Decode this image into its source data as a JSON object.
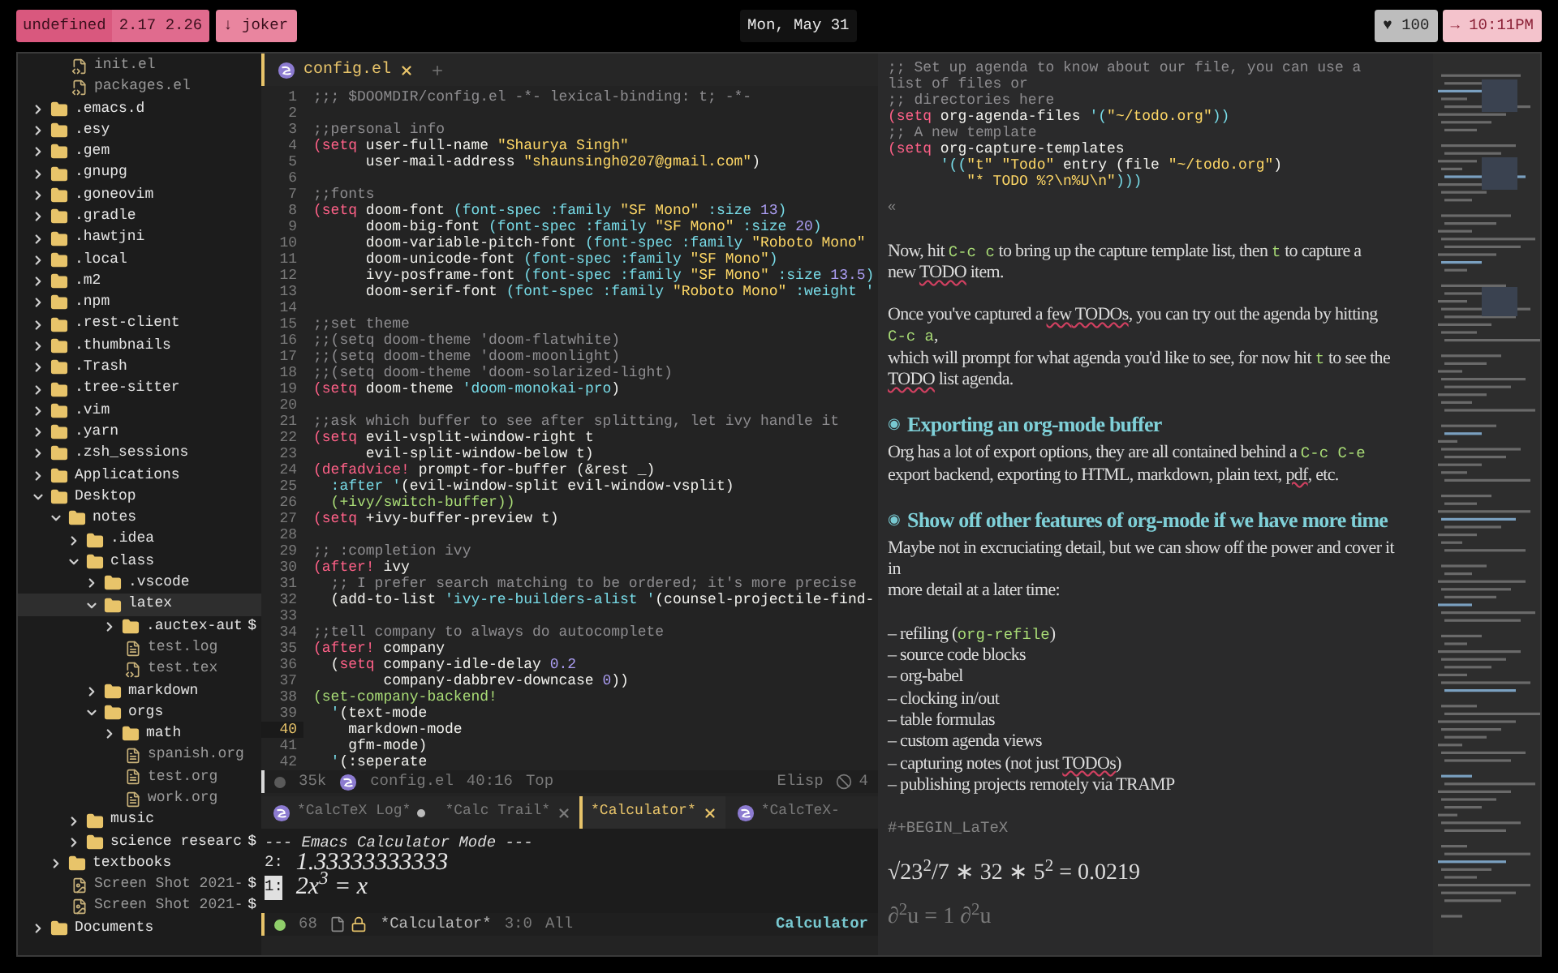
{
  "topbar": {
    "workspace": "undefined",
    "load": "2.17 2.26",
    "branch": "↓ joker",
    "date": "Mon, May 31",
    "battery": "♥ 100",
    "time": "→ 10:11PM"
  },
  "sidebar": {
    "items": [
      {
        "kind": "continuation",
        "children": [
          {
            "name": "init.el",
            "kind": "code",
            "selected": false
          },
          {
            "name": "packages.el",
            "kind": "code",
            "selected": false
          }
        ]
      },
      {
        "name": ".emacs.d",
        "kind": "folder",
        "expanded": false,
        "selected": false
      },
      {
        "name": ".esy",
        "kind": "folder",
        "expanded": false,
        "selected": false
      },
      {
        "name": ".gem",
        "kind": "folder",
        "expanded": false,
        "selected": false
      },
      {
        "name": ".gnupg",
        "kind": "folder",
        "expanded": false,
        "selected": false
      },
      {
        "name": ".goneovim",
        "kind": "folder",
        "expanded": false,
        "selected": false
      },
      {
        "name": ".gradle",
        "kind": "folder",
        "expanded": false,
        "selected": false
      },
      {
        "name": ".hawtjni",
        "kind": "folder",
        "expanded": false,
        "selected": false
      },
      {
        "name": ".local",
        "kind": "folder",
        "expanded": false,
        "selected": false
      },
      {
        "name": ".m2",
        "kind": "folder",
        "expanded": false,
        "selected": false
      },
      {
        "name": ".npm",
        "kind": "folder",
        "expanded": false,
        "selected": false
      },
      {
        "name": ".rest-client",
        "kind": "folder",
        "expanded": false,
        "selected": false
      },
      {
        "name": ".thumbnails",
        "kind": "folder",
        "expanded": false,
        "selected": false
      },
      {
        "name": ".Trash",
        "kind": "folder",
        "expanded": false,
        "selected": false
      },
      {
        "name": ".tree-sitter",
        "kind": "folder",
        "expanded": false,
        "selected": false
      },
      {
        "name": ".vim",
        "kind": "folder",
        "expanded": false,
        "selected": false
      },
      {
        "name": ".yarn",
        "kind": "folder",
        "expanded": false,
        "selected": false
      },
      {
        "name": ".zsh_sessions",
        "kind": "folder",
        "expanded": false,
        "selected": false
      },
      {
        "name": "Applications",
        "kind": "folder",
        "expanded": false,
        "selected": false
      },
      {
        "name": "Desktop",
        "kind": "folder",
        "expanded": true,
        "selected": false,
        "children": [
          {
            "name": "notes",
            "kind": "folder",
            "expanded": true,
            "selected": false,
            "children": [
              {
                "name": ".idea",
                "kind": "folder",
                "expanded": false,
                "selected": false
              },
              {
                "name": "class",
                "kind": "folder",
                "expanded": true,
                "selected": false,
                "children": [
                  {
                    "name": ".vscode",
                    "kind": "folder",
                    "expanded": false,
                    "selected": false
                  },
                  {
                    "name": "latex",
                    "kind": "folder",
                    "expanded": true,
                    "selected": true,
                    "children": [
                      {
                        "name": ".auctex-aut",
                        "kind": "folder",
                        "expanded": false,
                        "selected": false,
                        "marker": "$"
                      },
                      {
                        "name": "test.log",
                        "kind": "text",
                        "selected": false
                      },
                      {
                        "name": "test.tex",
                        "kind": "code",
                        "selected": false
                      }
                    ]
                  },
                  {
                    "name": "markdown",
                    "kind": "folder",
                    "expanded": false,
                    "selected": false
                  },
                  {
                    "name": "orgs",
                    "kind": "folder",
                    "expanded": true,
                    "selected": false,
                    "children": [
                      {
                        "name": "math",
                        "kind": "folder",
                        "expanded": false,
                        "selected": false
                      },
                      {
                        "name": "spanish.org",
                        "kind": "text",
                        "selected": false
                      },
                      {
                        "name": "test.org",
                        "kind": "text",
                        "selected": false
                      },
                      {
                        "name": "work.org",
                        "kind": "text",
                        "selected": false
                      }
                    ]
                  }
                ]
              },
              {
                "name": "music",
                "kind": "folder",
                "expanded": false,
                "selected": false
              },
              {
                "name": "science researc",
                "kind": "folder",
                "expanded": false,
                "selected": false,
                "marker": "$"
              }
            ]
          },
          {
            "name": "textbooks",
            "kind": "folder",
            "expanded": false,
            "selected": false
          },
          {
            "name": "Screen Shot 2021-",
            "kind": "image",
            "selected": false,
            "marker": "$"
          },
          {
            "name": "Screen Shot 2021-",
            "kind": "image",
            "selected": false,
            "marker": "$"
          }
        ]
      },
      {
        "name": "Documents",
        "kind": "folder",
        "expanded": false,
        "selected": false
      }
    ]
  },
  "editor": {
    "tabs": [
      {
        "label": "config.el",
        "selected": true
      }
    ],
    "lines": [
      {
        "number": "1",
        "current": false,
        "parts": [
          {
            "text": ";;; $DOOMDIR/config.el -*- lexical-binding: t; -*-",
            "kind": "c"
          }
        ]
      },
      {
        "number": "2",
        "current": false
      },
      {
        "number": "3",
        "current": false,
        "parts": [
          {
            "text": ";;personal info",
            "kind": "c"
          }
        ]
      },
      {
        "number": "4",
        "current": false,
        "parts": [
          {
            "text": "(setq",
            "kind": "k"
          },
          {
            "text": " user-full-name ",
            "kind": "d"
          },
          {
            "text": "\"Shaurya Singh\"",
            "kind": "s"
          }
        ]
      },
      {
        "number": "5",
        "current": false,
        "parts": [
          {
            "text": "      user-mail-address ",
            "kind": "d"
          },
          {
            "text": "\"shaunsingh0207@gmail.com\"",
            "kind": "s"
          },
          {
            "text": ")",
            "kind": "d"
          }
        ]
      },
      {
        "number": "6",
        "current": false
      },
      {
        "number": "7",
        "current": false,
        "parts": [
          {
            "text": ";;fonts",
            "kind": "c"
          }
        ]
      },
      {
        "number": "8",
        "current": false,
        "parts": [
          {
            "text": "(setq",
            "kind": "k"
          },
          {
            "text": " doom-font ",
            "kind": "d"
          },
          {
            "text": "(font-spec :family ",
            "kind": "f"
          },
          {
            "text": "\"SF Mono\"",
            "kind": "s"
          },
          {
            "text": " :size ",
            "kind": "f"
          },
          {
            "text": "13",
            "kind": "n"
          },
          {
            "text": ")",
            "kind": "f"
          }
        ]
      },
      {
        "number": "9",
        "current": false,
        "parts": [
          {
            "text": "      doom-big-font ",
            "kind": "d"
          },
          {
            "text": "(font-spec :family ",
            "kind": "f"
          },
          {
            "text": "\"SF Mono\"",
            "kind": "s"
          },
          {
            "text": " :size ",
            "kind": "f"
          },
          {
            "text": "20",
            "kind": "n"
          },
          {
            "text": ")",
            "kind": "f"
          }
        ]
      },
      {
        "number": "10",
        "current": false,
        "parts": [
          {
            "text": "      doom-variable-pitch-font ",
            "kind": "d"
          },
          {
            "text": "(font-spec :family ",
            "kind": "f"
          },
          {
            "text": "\"Roboto Mono\"",
            "kind": "s"
          }
        ]
      },
      {
        "number": "11",
        "current": false,
        "parts": [
          {
            "text": "      doom-unicode-font ",
            "kind": "d"
          },
          {
            "text": "(font-spec :family ",
            "kind": "f"
          },
          {
            "text": "\"SF Mono\"",
            "kind": "s"
          },
          {
            "text": ")",
            "kind": "f"
          }
        ]
      },
      {
        "number": "12",
        "current": false,
        "parts": [
          {
            "text": "      ivy-posframe-font ",
            "kind": "d"
          },
          {
            "text": "(font-spec :family ",
            "kind": "f"
          },
          {
            "text": "\"SF Mono\"",
            "kind": "s"
          },
          {
            "text": " :size ",
            "kind": "f"
          },
          {
            "text": "13.5",
            "kind": "n"
          },
          {
            "text": ")",
            "kind": "f"
          }
        ]
      },
      {
        "number": "13",
        "current": false,
        "parts": [
          {
            "text": "      doom-serif-font ",
            "kind": "d"
          },
          {
            "text": "(font-spec :family ",
            "kind": "f"
          },
          {
            "text": "\"Roboto Mono\"",
            "kind": "s"
          },
          {
            "text": " :weight '",
            "kind": "f"
          }
        ]
      },
      {
        "number": "14",
        "current": false
      },
      {
        "number": "15",
        "current": false,
        "parts": [
          {
            "text": ";;set theme",
            "kind": "c"
          }
        ]
      },
      {
        "number": "16",
        "current": false,
        "parts": [
          {
            "text": ";;(setq doom-theme 'doom-flatwhite)",
            "kind": "c"
          }
        ]
      },
      {
        "number": "17",
        "current": false,
        "parts": [
          {
            "text": ";;(setq doom-theme 'doom-moonlight)",
            "kind": "c"
          }
        ]
      },
      {
        "number": "18",
        "current": false,
        "parts": [
          {
            "text": ";;(setq doom-theme 'doom-solarized-light)",
            "kind": "c"
          }
        ]
      },
      {
        "number": "19",
        "current": false,
        "parts": [
          {
            "text": "(setq",
            "kind": "k"
          },
          {
            "text": " doom-theme ",
            "kind": "d"
          },
          {
            "text": "'doom-monokai-pro",
            "kind": "f"
          },
          {
            "text": ")",
            "kind": "d"
          }
        ]
      },
      {
        "number": "20",
        "current": false
      },
      {
        "number": "21",
        "current": false,
        "parts": [
          {
            "text": ";;ask which buffer to see after splitting, let ivy handle it",
            "kind": "c"
          }
        ]
      },
      {
        "number": "22",
        "current": false,
        "parts": [
          {
            "text": "(setq",
            "kind": "k"
          },
          {
            "text": " evil-vsplit-window-right t",
            "kind": "d"
          }
        ]
      },
      {
        "number": "23",
        "current": false,
        "parts": [
          {
            "text": "      evil-split-window-below t)",
            "kind": "d"
          }
        ]
      },
      {
        "number": "24",
        "current": false,
        "parts": [
          {
            "text": "(defadvice!",
            "kind": "k"
          },
          {
            "text": " prompt-for-buffer (&rest _)",
            "kind": "d"
          }
        ]
      },
      {
        "number": "25",
        "current": false,
        "parts": [
          {
            "text": "  :after '",
            "kind": "f"
          },
          {
            "text": "(evil-window-split evil-window-vsplit)",
            "kind": "d"
          }
        ]
      },
      {
        "number": "26",
        "current": false,
        "parts": [
          {
            "text": "  (+ivy/switch-buffer))",
            "kind": "g"
          }
        ]
      },
      {
        "number": "27",
        "current": false,
        "parts": [
          {
            "text": "(setq",
            "kind": "k"
          },
          {
            "text": " +ivy-buffer-preview t)",
            "kind": "d"
          }
        ]
      },
      {
        "number": "28",
        "current": false
      },
      {
        "number": "29",
        "current": false,
        "parts": [
          {
            "text": ";; :completion ivy",
            "kind": "c"
          }
        ]
      },
      {
        "number": "30",
        "current": false,
        "parts": [
          {
            "text": "(after!",
            "kind": "k"
          },
          {
            "text": " ivy",
            "kind": "d"
          }
        ]
      },
      {
        "number": "31",
        "current": false,
        "parts": [
          {
            "text": "  ;; I prefer search matching to be ordered; it's more precise",
            "kind": "c"
          }
        ]
      },
      {
        "number": "32",
        "current": false,
        "parts": [
          {
            "text": "  (add-to-list ",
            "kind": "d"
          },
          {
            "text": "'ivy-re-builders-alist '",
            "kind": "f"
          },
          {
            "text": "(counsel-projectile-find-",
            "kind": "d"
          }
        ]
      },
      {
        "number": "33",
        "current": false
      },
      {
        "number": "34",
        "current": false,
        "parts": [
          {
            "text": ";;tell company to always do autocomplete",
            "kind": "c"
          }
        ]
      },
      {
        "number": "35",
        "current": false,
        "parts": [
          {
            "text": "(after!",
            "kind": "k"
          },
          {
            "text": " company",
            "kind": "d"
          }
        ]
      },
      {
        "number": "36",
        "current": false,
        "parts": [
          {
            "text": "  (",
            "kind": "d"
          },
          {
            "text": "setq",
            "kind": "k"
          },
          {
            "text": " company-idle-delay ",
            "kind": "d"
          },
          {
            "text": "0.2",
            "kind": "n"
          }
        ]
      },
      {
        "number": "37",
        "current": false,
        "parts": [
          {
            "text": "        company-dabbrev-downcase ",
            "kind": "d"
          },
          {
            "text": "0",
            "kind": "n"
          },
          {
            "text": "))",
            "kind": "d"
          }
        ]
      },
      {
        "number": "38",
        "current": false,
        "parts": [
          {
            "text": "(set-company-backend!",
            "kind": "g"
          }
        ]
      },
      {
        "number": "39",
        "current": false,
        "parts": [
          {
            "text": "  '",
            "kind": "f"
          },
          {
            "text": "(text-mode",
            "kind": "d"
          }
        ]
      },
      {
        "number": "40",
        "current": true,
        "parts": [
          {
            "text": "    markdown-mode",
            "kind": "d"
          }
        ]
      },
      {
        "number": "41",
        "current": false,
        "parts": [
          {
            "text": "    gfm-mode)",
            "kind": "d"
          }
        ]
      },
      {
        "number": "42",
        "current": false,
        "parts": [
          {
            "text": "  '",
            "kind": "f"
          },
          {
            "text": "(:seperate",
            "kind": "d"
          }
        ]
      }
    ],
    "modeline": {
      "size": "35k",
      "buffer": "config.el",
      "position": "40:16",
      "scroll": "Top",
      "mode": "Elisp",
      "extra": "4"
    }
  },
  "calc": {
    "tabs": [
      {
        "label": "*CalcTeX Log*",
        "logo": true,
        "modified": true,
        "closable": false,
        "selected": false
      },
      {
        "label": "*Calc Trail*",
        "logo": false,
        "modified": false,
        "closable": true,
        "selected": false
      },
      {
        "label": "*Calculator*",
        "logo": false,
        "modified": false,
        "closable": true,
        "selected": true
      },
      {
        "label": "*CalcTeX-",
        "logo": true,
        "modified": false,
        "closable": false,
        "selected": false
      }
    ],
    "header": "--- Emacs Calculator Mode ---",
    "stack": [
      {
        "index": "2:",
        "value": "1.33333333333",
        "cursor": false
      },
      {
        "index": "1:",
        "value": "2x$^{3}$ = x",
        "cursor": true
      }
    ],
    "modeline": {
      "size": "68",
      "buffer": "*Calculator*",
      "position": "3:0",
      "scroll": "All",
      "mode": "Calculator"
    }
  },
  "org": {
    "blocks": [
      {
        "kind": "code",
        "lines": [
          [
            {
              "text": ";; Set up agenda to know about our file, you can use a",
              "kind": "c"
            }
          ],
          [
            {
              "text": "list of files or",
              "kind": "c"
            }
          ],
          [
            {
              "text": ";; directories here",
              "kind": "c"
            }
          ],
          [
            {
              "text": "(setq",
              "kind": "k"
            },
            {
              "text": " org-agenda-files ",
              "kind": "d"
            },
            {
              "text": "'(",
              "kind": "f"
            },
            {
              "text": "\"~/todo.org\"",
              "kind": "s"
            },
            {
              "text": "))",
              "kind": "f"
            }
          ],
          [
            {
              "text": ";; A new template",
              "kind": "c"
            }
          ],
          [
            {
              "text": "(setq",
              "kind": "k"
            },
            {
              "text": " org-capture-templates",
              "kind": "d"
            }
          ],
          [
            {
              "text": "      '((",
              "kind": "f"
            },
            {
              "text": "\"t\" \"Todo\"",
              "kind": "s"
            },
            {
              "text": " entry (file ",
              "kind": "d"
            },
            {
              "text": "\"~/todo.org\"",
              "kind": "s"
            },
            {
              "text": ")",
              "kind": "d"
            }
          ],
          [
            {
              "text": "         \"* TODO %?\\n%U\\n\"",
              "kind": "s"
            },
            {
              "text": ")))",
              "kind": "f"
            }
          ]
        ]
      },
      {
        "kind": "glyph",
        "text": "«"
      },
      {
        "kind": "paragraph",
        "lines": [
          [
            {
              "text": "Now, hit ",
              "kind": "t"
            },
            {
              "text": "C-c c",
              "kind": "code"
            },
            {
              "text": " to bring up the capture template list, then ",
              "kind": "t"
            },
            {
              "text": "t",
              "kind": "code"
            },
            {
              "text": " to capture a",
              "kind": "t"
            }
          ],
          [
            {
              "text": "new ",
              "kind": "t"
            },
            {
              "text": "TODO",
              "kind": "spell"
            },
            {
              "text": " item.",
              "kind": "t"
            }
          ]
        ]
      },
      {
        "kind": "paragraph",
        "lines": [
          [
            {
              "text": "Once you've captured a ",
              "kind": "t"
            },
            {
              "text": "few",
              "kind": "spell"
            },
            {
              "text": " TODOs",
              "kind": "spell"
            },
            {
              "text": ", you can try out the agenda by hitting",
              "kind": "t"
            }
          ],
          [
            {
              "text": "C-c a",
              "kind": "code"
            },
            {
              "text": ",",
              "kind": "t"
            }
          ],
          [
            {
              "text": "which will prompt for what agenda you'd like to see, for now hit ",
              "kind": "t"
            },
            {
              "text": "t",
              "kind": "code"
            },
            {
              "text": " to see the",
              "kind": "t"
            }
          ],
          [
            {
              "text": "TODO",
              "kind": "spell"
            },
            {
              "text": " list agenda.",
              "kind": "t"
            }
          ]
        ]
      },
      {
        "kind": "heading",
        "marker": "◉",
        "text": "Exporting an org-mode buffer"
      },
      {
        "kind": "paragraph",
        "lines": [
          [
            {
              "text": "Org has a lot of export options, they are all contained behind a ",
              "kind": "t"
            },
            {
              "text": "C-c C-e",
              "kind": "code"
            }
          ],
          [
            {
              "text": "export backend, exporting to HTML, markdown, plain text, ",
              "kind": "t"
            },
            {
              "text": "pdf",
              "kind": "spell"
            },
            {
              "text": ", etc.",
              "kind": "t"
            }
          ]
        ]
      },
      {
        "kind": "heading",
        "marker": "◉",
        "text": "Show off other features of org-mode if we have more time"
      },
      {
        "kind": "paragraph",
        "lines": [
          [
            {
              "text": "Maybe not in excruciating detail, but we can show off the power and cover it",
              "kind": "t"
            }
          ],
          [
            {
              "text": "in",
              "kind": "t"
            }
          ],
          [
            {
              "text": "more detail at a later time:",
              "kind": "t"
            }
          ]
        ]
      },
      {
        "kind": "paragraph",
        "lines": [
          [
            {
              "text": "– refiling (",
              "kind": "t"
            },
            {
              "text": "org-refile",
              "kind": "code"
            },
            {
              "text": ")",
              "kind": "t"
            }
          ],
          [
            {
              "text": "– source code blocks",
              "kind": "t"
            }
          ],
          [
            {
              "text": "– org-babel",
              "kind": "t"
            }
          ],
          [
            {
              "text": "– clocking in/out",
              "kind": "t"
            }
          ],
          [
            {
              "text": "– table formulas",
              "kind": "t"
            }
          ],
          [
            {
              "text": "– custom agenda views",
              "kind": "t"
            }
          ],
          [
            {
              "text": "– capturing notes (not just ",
              "kind": "t"
            },
            {
              "text": "TODOs",
              "kind": "spell"
            },
            {
              "text": ")",
              "kind": "t"
            }
          ],
          [
            {
              "text": "– publishing projects remotely via TRAMP",
              "kind": "t"
            }
          ]
        ]
      },
      {
        "kind": "keyword",
        "text": "#+BEGIN_LaTeX"
      },
      {
        "kind": "math",
        "text": "√23$^{2}$/7 ∗ 32 ∗ 5$^{2}$ = 0.0219",
        "faded": false
      },
      {
        "kind": "math",
        "text": "∂$^{2}$u = 1 ∂$^{2}$u",
        "faded": true
      }
    ]
  }
}
